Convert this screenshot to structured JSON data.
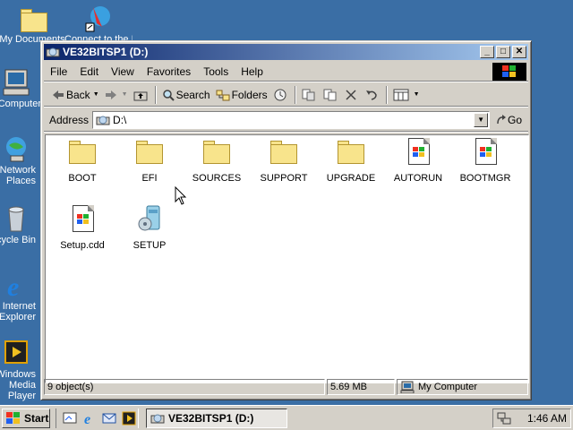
{
  "desktop": {
    "icons": [
      {
        "label": "My Documents",
        "icon": "folder-icon"
      },
      {
        "label": "Connect to the Internet",
        "icon": "connect-icon"
      },
      {
        "label": "My Computer",
        "icon": "computer-icon"
      },
      {
        "label": "My Network Places",
        "icon": "network-icon"
      },
      {
        "label": "Recycle Bin",
        "icon": "recycle-bin-icon"
      },
      {
        "label": "Internet Explorer",
        "icon": "ie-icon"
      },
      {
        "label": "Windows Media Player",
        "icon": "media-player-icon"
      }
    ]
  },
  "window": {
    "title": "VE32BITSP1 (D:)",
    "menu": [
      "File",
      "Edit",
      "View",
      "Favorites",
      "Tools",
      "Help"
    ],
    "toolbar": {
      "back_label": "Back",
      "search_label": "Search",
      "folders_label": "Folders"
    },
    "address": {
      "label": "Address",
      "value": "D:\\",
      "go_label": "Go"
    },
    "files": [
      {
        "name": "BOOT",
        "type": "folder"
      },
      {
        "name": "EFI",
        "type": "folder"
      },
      {
        "name": "SOURCES",
        "type": "folder"
      },
      {
        "name": "SUPPORT",
        "type": "folder"
      },
      {
        "name": "UPGRADE",
        "type": "folder"
      },
      {
        "name": "AUTORUN",
        "type": "document"
      },
      {
        "name": "BOOTMGR",
        "type": "document"
      },
      {
        "name": "Setup.cdd",
        "type": "document"
      },
      {
        "name": "SETUP",
        "type": "setup"
      }
    ],
    "status": {
      "objects": "9 object(s)",
      "size": "5.69 MB",
      "zone": "My Computer"
    }
  },
  "taskbar": {
    "start_label": "Start",
    "task_label": "VE32BITSP1 (D:)",
    "clock": "1:46 AM"
  }
}
